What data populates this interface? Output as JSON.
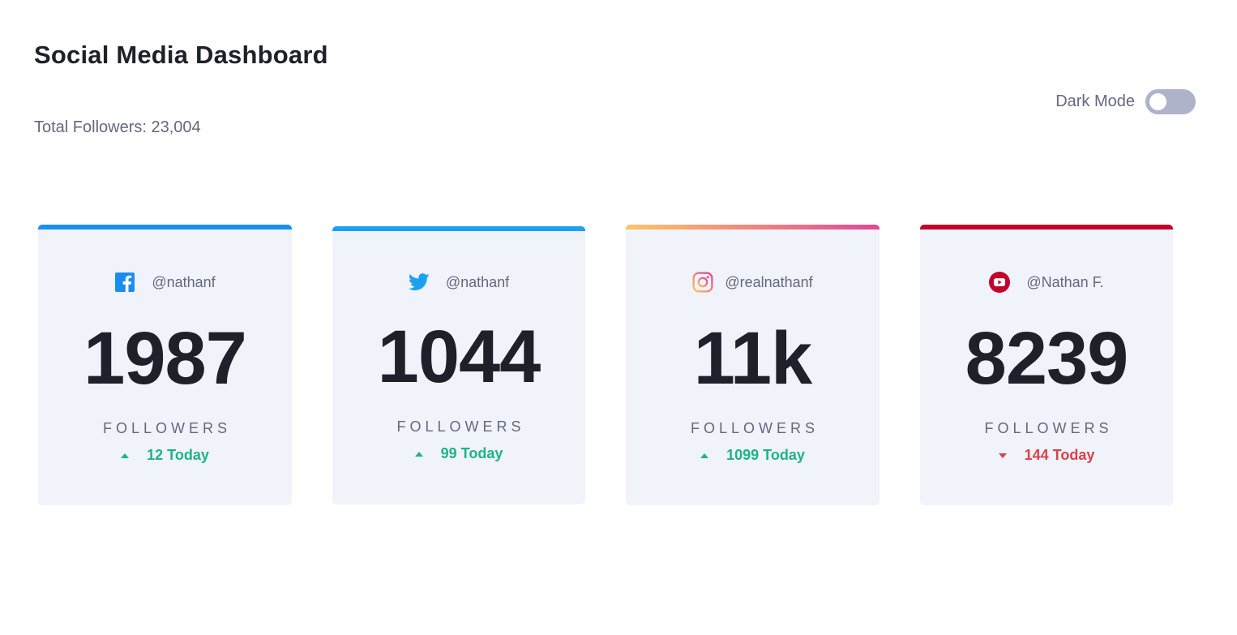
{
  "header": {
    "title": "Social Media Dashboard",
    "total_followers": "Total Followers: 23,004"
  },
  "dark_mode": {
    "label": "Dark Mode",
    "enabled": false
  },
  "cards": [
    {
      "platform": "facebook",
      "icon": "facebook-icon",
      "accent": "#198ef0",
      "handle": "@nathanf",
      "count": "1987",
      "label": "FOLLOWERS",
      "delta": "12 Today",
      "trend": "up"
    },
    {
      "platform": "twitter",
      "icon": "twitter-icon",
      "accent": "#1ca0f2",
      "handle": "@nathanf",
      "count": "1044",
      "label": "FOLLOWERS",
      "delta": "99 Today",
      "trend": "up"
    },
    {
      "platform": "instagram",
      "icon": "instagram-icon",
      "accent": "#df4996",
      "handle": "@realnathanf",
      "count": "11k",
      "label": "FOLLOWERS",
      "delta": "1099 Today",
      "trend": "up"
    },
    {
      "platform": "youtube",
      "icon": "youtube-icon",
      "accent": "#c4032a",
      "handle": "@Nathan F.",
      "count": "8239",
      "label": "FOLLOWERS",
      "delta": "144 Today",
      "trend": "down"
    }
  ],
  "colors": {
    "up": "#1db489",
    "down": "#dc414c",
    "card_bg": "#f0f3fa",
    "text_dark": "#1e202a",
    "text_muted": "#63687e",
    "toggle": "#aeb3cb"
  }
}
